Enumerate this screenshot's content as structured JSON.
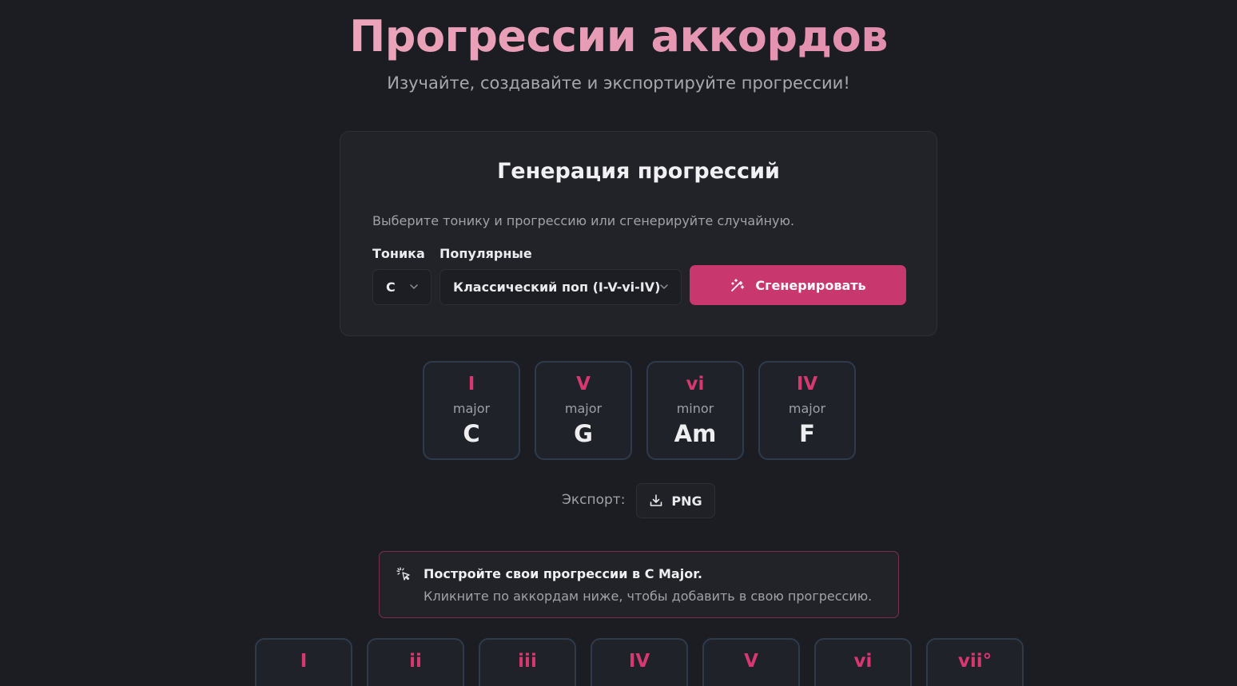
{
  "header": {
    "title": "Прогрессии аккордов",
    "subtitle": "Изучайте, создавайте и экспортируйте прогрессии!"
  },
  "generator": {
    "title": "Генерация прогрессий",
    "description": "Выберите тонику и прогрессию или сгенерируйте случайную.",
    "tonic_label": "Тоника",
    "tonic_value": "C",
    "popular_label": "Популярные",
    "popular_value": "Классический поп (I-V-vi-IV)",
    "generate_label": "Сгенерировать"
  },
  "progression": [
    {
      "numeral": "I",
      "quality": "major",
      "chord": "C"
    },
    {
      "numeral": "V",
      "quality": "major",
      "chord": "G"
    },
    {
      "numeral": "vi",
      "quality": "minor",
      "chord": "Am"
    },
    {
      "numeral": "IV",
      "quality": "major",
      "chord": "F"
    }
  ],
  "export": {
    "label": "Экспорт:",
    "png_label": "PNG"
  },
  "info": {
    "title": "Постройте свои прогрессии в C Major.",
    "text": "Кликните по аккордам ниже, чтобы добавить в свою прогрессию."
  },
  "scale_chords": [
    "I",
    "ii",
    "iii",
    "IV",
    "V",
    "vi",
    "vii°"
  ],
  "colors": {
    "accent": "#c9376f",
    "numeral": "#d6386f",
    "background": "#1b1d22"
  }
}
